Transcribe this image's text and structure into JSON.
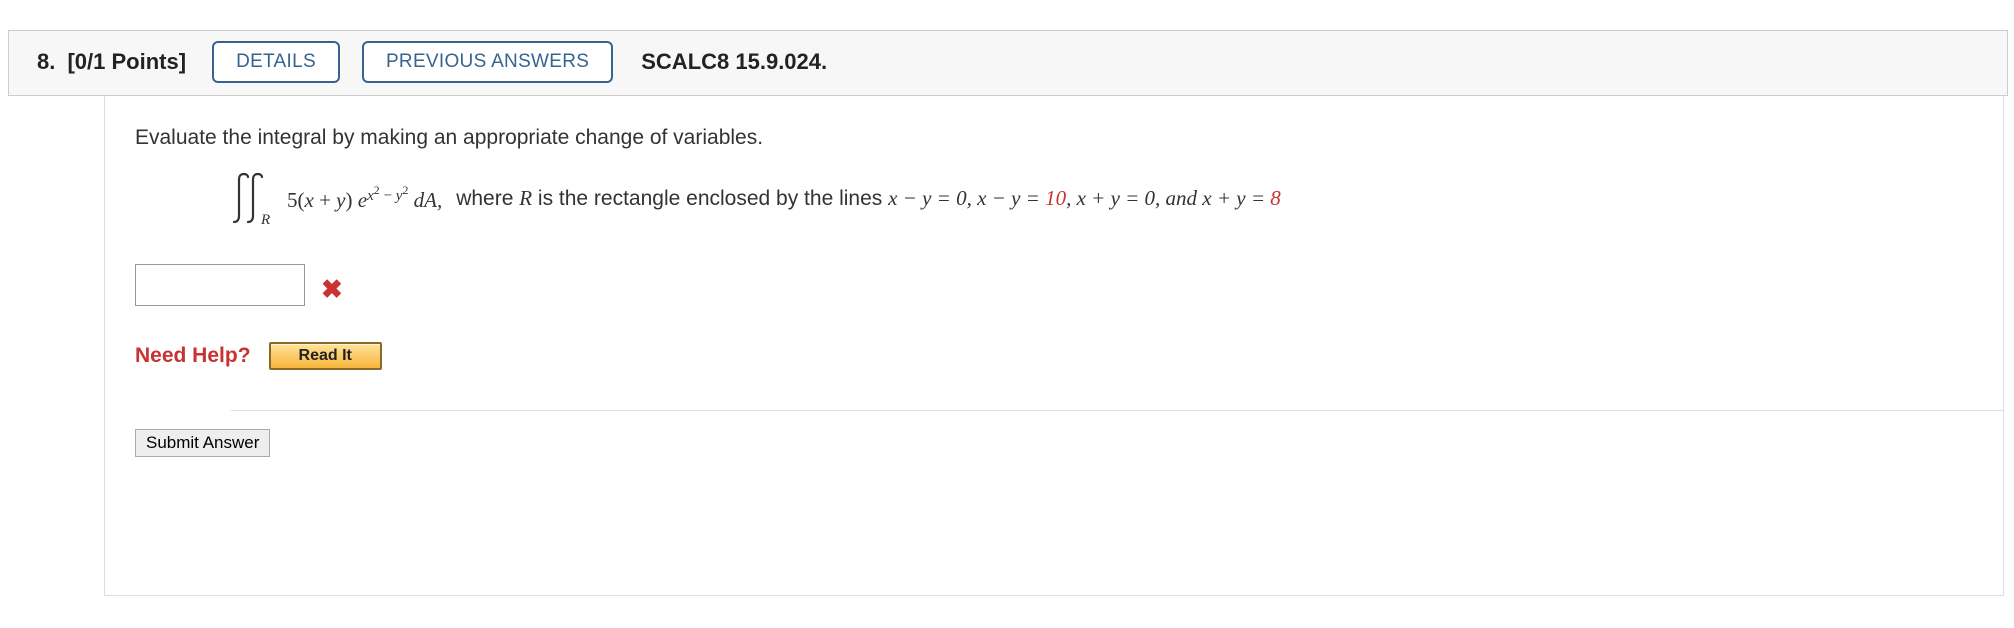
{
  "header": {
    "number": "8.",
    "points": "[0/1 Points]",
    "details_label": "DETAILS",
    "previous_label": "PREVIOUS ANSWERS",
    "textbook_ref": "SCALC8 15.9.024."
  },
  "question": {
    "prompt": "Evaluate the integral by making an appropriate change of variables.",
    "integrand_coeff": "5",
    "integrand_factor_open": "(",
    "integrand_var1": "x",
    "integrand_plus": " + ",
    "integrand_var2": "y",
    "integrand_factor_close": ") ",
    "integrand_e": "e",
    "exp_x2": "x",
    "exp_sq1": "2",
    "exp_minus": " − ",
    "exp_y2": "y",
    "exp_sq2": "2",
    "integrand_dA": " dA,",
    "region_R": "R",
    "desc_pre": "where ",
    "desc_R": "R",
    "desc_mid": " is the rectangle enclosed by the lines  ",
    "eq1": "x − y = 0,   x − y = ",
    "eq1_val": "10",
    "eq2": ",   x + y = 0,  and  x + y = ",
    "eq2_val": "8"
  },
  "feedback": {
    "status_icon": "✖"
  },
  "help": {
    "label": "Need Help?",
    "read_it": "Read It"
  },
  "submit": {
    "label": "Submit Answer"
  }
}
